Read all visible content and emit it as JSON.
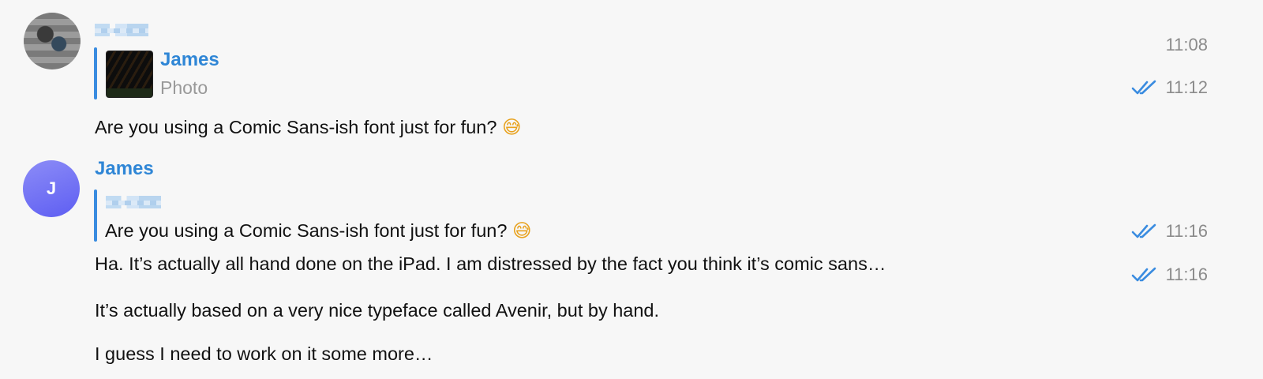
{
  "messages": [
    {
      "time": "11:08",
      "reply": {
        "sender": "James",
        "preview": "Photo"
      },
      "reply_time": "11:12",
      "text": "Are you using a Comic Sans-ish font just for fun?",
      "emoji": "😅"
    },
    {
      "sender": "James",
      "avatar_letter": "J",
      "reply_quote": "Are you using a Comic Sans-ish font just for fun?",
      "reply_emoji": "😅",
      "reply_time": "11:16",
      "lines": [
        {
          "text": "Ha. It’s actually all hand done on the iPad. I am distressed by the fact you think it’s comic sans…",
          "time": "11:16"
        },
        {
          "text": "It’s actually based on a very nice typeface called Avenir, but by hand."
        },
        {
          "text": "I guess I need to work on it some more…"
        }
      ]
    }
  ],
  "colors": {
    "accent": "#2f86d6",
    "reply_bar": "#3a8ce0",
    "avatar_gradient_end": "#5e5ef2"
  },
  "icons": {
    "read_receipt": "double-check-icon"
  }
}
